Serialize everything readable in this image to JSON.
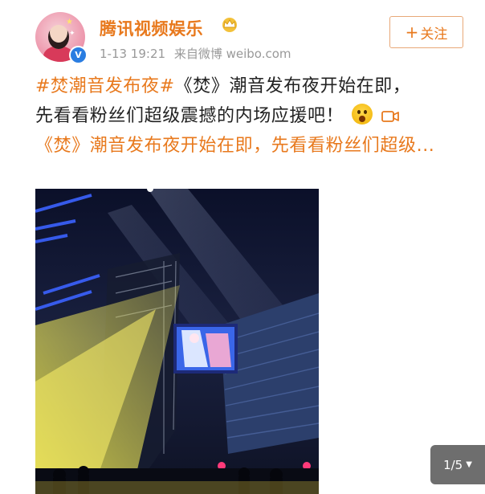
{
  "post": {
    "author": "腾讯视频娱乐",
    "time": "1-13 19:21",
    "source": "来自微博 weibo.com",
    "follow_label": "关注",
    "follow_plus": "+",
    "text_hashtag": "#焚潮音发布夜#",
    "text_line1": "《焚》潮音发布夜开始在即，",
    "text_line2": "先看看粉丝们超级震撼的内场应援吧！",
    "text_link": "《焚》潮音发布夜开始在即，先看看粉丝们超级...",
    "emoji_icon": "shocked-face-emoji",
    "video_icon": "video-camera-icon"
  },
  "gallery": {
    "counter": "1/5",
    "caret": "▼"
  },
  "colors": {
    "accent": "#e8791d",
    "verified": "#2a7de1",
    "text": "#222222",
    "meta": "#999999"
  }
}
